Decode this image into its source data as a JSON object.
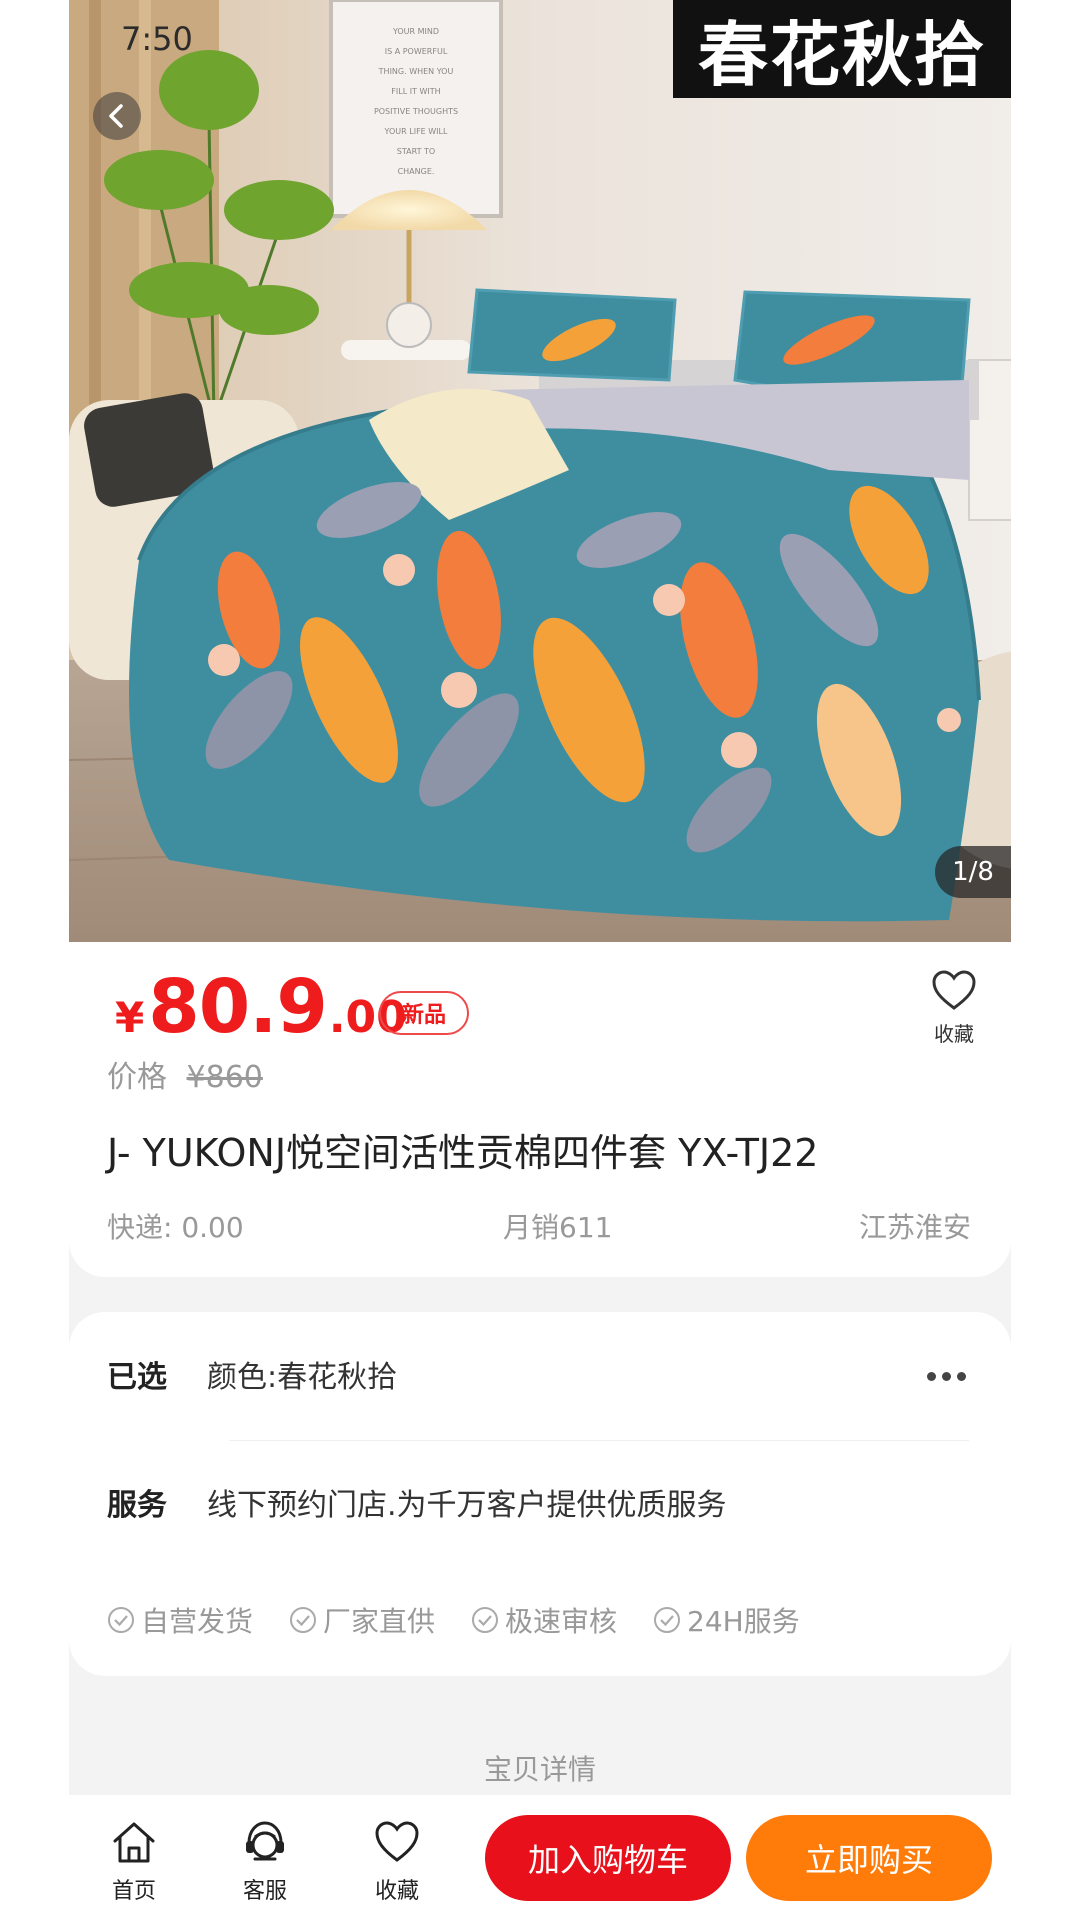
{
  "status_bar": {
    "time": "7:50"
  },
  "hero": {
    "brand_tag": "春花秋拾",
    "image_counter": "1/8",
    "poster_lines": [
      "YOUR MIND",
      "IS A POWERFUL",
      "THING. WHEN YOU",
      "FILL IT WITH",
      "POSITIVE THOUGHTS",
      "YOUR LIFE WILL",
      "START TO",
      "CHANGE."
    ]
  },
  "product": {
    "currency": "¥",
    "price_main": "80.9",
    "price_decimal": ".00",
    "badge": "新品",
    "original_price_label": "价格",
    "original_price": "¥860",
    "title": "J- YUKONJ悦空间活性贡棉四件套 YX-TJ22",
    "shipping": "快递: 0.00",
    "monthly_sales": "月销611",
    "location": "江苏淮安",
    "favorite_label": "收藏"
  },
  "specs": {
    "selected_key": "已选",
    "selected_value": "颜色:春花秋拾",
    "service_key": "服务",
    "service_value": "线下预约门店.为千万客户提供优质服务",
    "guarantees": [
      "自营发货",
      "厂家直供",
      "极速审核",
      "24H服务"
    ]
  },
  "detail_label": "宝贝详情",
  "bottom_bar": {
    "home": "首页",
    "service": "客服",
    "favorite": "收藏",
    "add_to_cart": "加入购物车",
    "buy_now": "立即购买"
  },
  "colors": {
    "price_red": "#ee1c1c",
    "cart_red": "#e8101a",
    "buy_orange": "#ff7b0a",
    "duvet_teal": "#3f8ea0"
  }
}
